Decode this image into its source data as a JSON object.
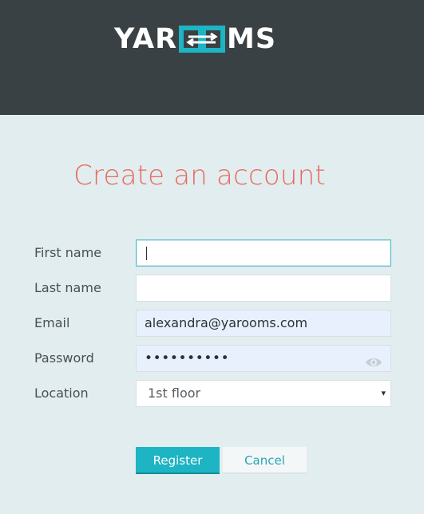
{
  "brand": {
    "logo_left": "YAR",
    "logo_right": "MS",
    "colors": {
      "header_bg": "#394144",
      "accent": "#1db4c4",
      "title": "#e86b5e"
    }
  },
  "title": "Create an account",
  "form": {
    "first_name": {
      "label": "First name",
      "value": ""
    },
    "last_name": {
      "label": "Last name",
      "value": ""
    },
    "email": {
      "label": "Email",
      "value": "alexandra@yarooms.com"
    },
    "password": {
      "label": "Password",
      "value": "••••••••••",
      "icon": "eye-icon"
    },
    "location": {
      "label": "Location",
      "selected": "1st floor",
      "icon": "dropdown-arrow-icon"
    }
  },
  "actions": {
    "register": "Register",
    "cancel": "Cancel"
  }
}
